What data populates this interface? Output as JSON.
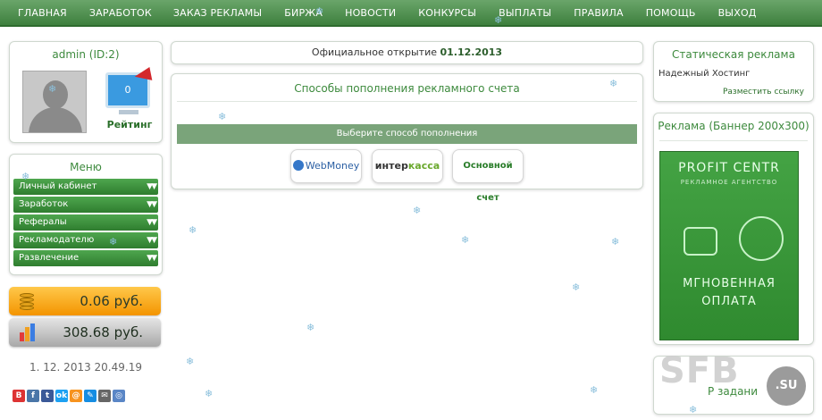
{
  "nav": [
    "ГЛАВНАЯ",
    "ЗАРАБОТОК",
    "ЗАКАЗ РЕКЛАМЫ",
    "БИРЖА",
    "НОВОСТИ",
    "КОНКУРСЫ",
    "ВЫПЛАТЫ",
    "ПРАВИЛА",
    "ПОМОЩЬ",
    "ВЫХОД"
  ],
  "user": {
    "title": "admin (ID:2)",
    "rating_value": "0",
    "rating_label": "Рейтинг"
  },
  "menu": {
    "title": "Меню",
    "items": [
      "Личный кабинет",
      "Заработок",
      "Рефералы",
      "Рекламодателю",
      "Развлечение"
    ]
  },
  "balances": {
    "main": "0.06 руб.",
    "secondary": "308.68 руб."
  },
  "datetime": "1. 12. 2013 20.49.19",
  "opening": {
    "label": "Официальное открытие",
    "date": "01.12.2013"
  },
  "payments": {
    "title": "Способы пополнения рекламного счета",
    "choose": "Выберите способ пополнения",
    "webmoney": "WebMoney",
    "interkassa_a": "интер",
    "interkassa_b": "касса",
    "main_account": "Основной счет"
  },
  "static_ads": {
    "title": "Статическая реклама",
    "link": "Надежный Хостинг",
    "place": "Разместить ссылку"
  },
  "banner": {
    "title": "Реклама (Баннер 200x300)",
    "brand": "PROFIT CENTR",
    "sub": "РЕКЛАМНОЕ АГЕНТСТВО",
    "line1": "МГНОВЕННАЯ",
    "line2": "ОПЛАТА"
  },
  "tasks": {
    "title": "Р задани"
  },
  "watermark": {
    "text": "SFB",
    "badge": ".SU"
  },
  "social": [
    "В",
    "f",
    "t",
    "ok",
    "@",
    "✎",
    "✉",
    "◎"
  ]
}
